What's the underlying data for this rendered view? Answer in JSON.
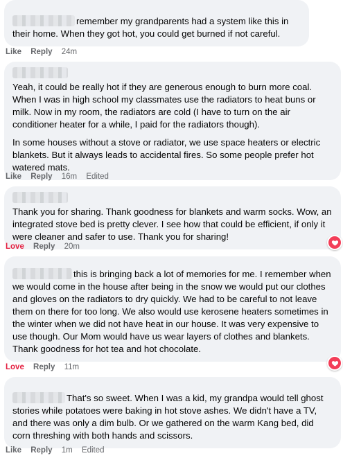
{
  "comments": [
    {
      "text_lines": [
        "remember my grandparents had a system like this in their home. When they got hot, you could get burned if not careful."
      ],
      "actions": {
        "like": "Like",
        "reply": "Reply",
        "time": "24m"
      }
    },
    {
      "paragraphs": [
        "Yeah, it could be really hot if they are generous enough to burn more coal. When I was in high school my classmates use the radiators to heat buns or milk. Now in my room, the radiators are cold (I have to turn on the air conditioner heater for a while, I paid for the radiators though).",
        "In some houses without a stove or radiator, we use space heaters or electric blankets. But it always leads to accidental fires. So some people prefer hot watered mats."
      ],
      "actions": {
        "like": "Like",
        "reply": "Reply",
        "time": "16m",
        "edited": "Edited"
      }
    },
    {
      "paragraphs": [
        "Thank you for sharing. Thank goodness for blankets and warm socks. Wow, an integrated stove bed is pretty clever. I see how that could be efficient, if only it were cleaner and safer to use. Thank you for sharing!"
      ],
      "actions": {
        "like": "Love",
        "reply": "Reply",
        "time": "20m"
      },
      "reaction": "heart-icon"
    },
    {
      "text": "this is bringing back a lot of memories for me. I remember when we would come in the house after being in the snow we would put our clothes and gloves on the radiators to dry quickly. We had to be careful to not leave them on there for too long. We also would use kerosene heaters sometimes in the winter when we did not have heat in our house. It was very expensive to use though. Our Mom would have us wear layers of clothes and blankets. Thank goodness for hot tea and hot chocolate.",
      "actions": {
        "like": "Love",
        "reply": "Reply",
        "time": "11m"
      },
      "reaction": "heart-icon"
    },
    {
      "text": "That's so sweet. When I was a kid, my grandpa would tell ghost stories while potatoes were baking in hot stove ashes. We didn't have a TV, and there was only a dim bulb. Or we gathered on the warm Kang bed, did corn threshing with both hands and scissors.",
      "actions": {
        "like": "Like",
        "reply": "Reply",
        "time": "1m",
        "edited": "Edited"
      }
    }
  ],
  "colors": {
    "bubble": "#f0f2f5",
    "love": "#e41e3f",
    "meta": "#65676b",
    "heart": "#f33e58"
  }
}
